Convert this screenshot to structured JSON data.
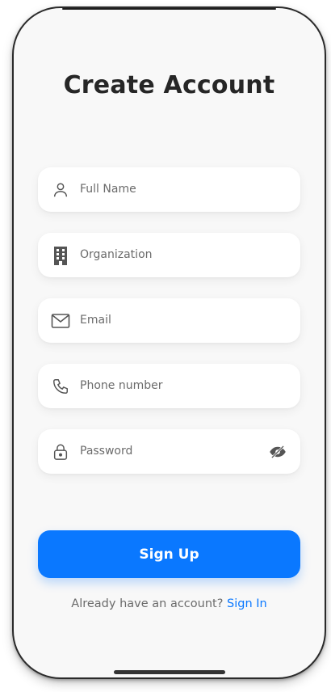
{
  "title": "Create Account",
  "fields": {
    "full_name": {
      "placeholder": "Full Name",
      "icon": "person-icon"
    },
    "organization": {
      "placeholder": "Organization",
      "icon": "building-icon"
    },
    "email": {
      "placeholder": "Email",
      "icon": "mail-icon"
    },
    "phone": {
      "placeholder": "Phone number",
      "icon": "phone-icon"
    },
    "password": {
      "placeholder": "Password",
      "icon": "lock-icon",
      "toggle_icon": "eye-slash-icon"
    }
  },
  "signup_button": "Sign Up",
  "footer": {
    "prompt": "Already have an account?",
    "link": "Sign In"
  },
  "colors": {
    "accent": "#0a78ff",
    "text_dark": "#262626",
    "text_muted": "#6b6b6b",
    "background": "#f8f8f8"
  }
}
